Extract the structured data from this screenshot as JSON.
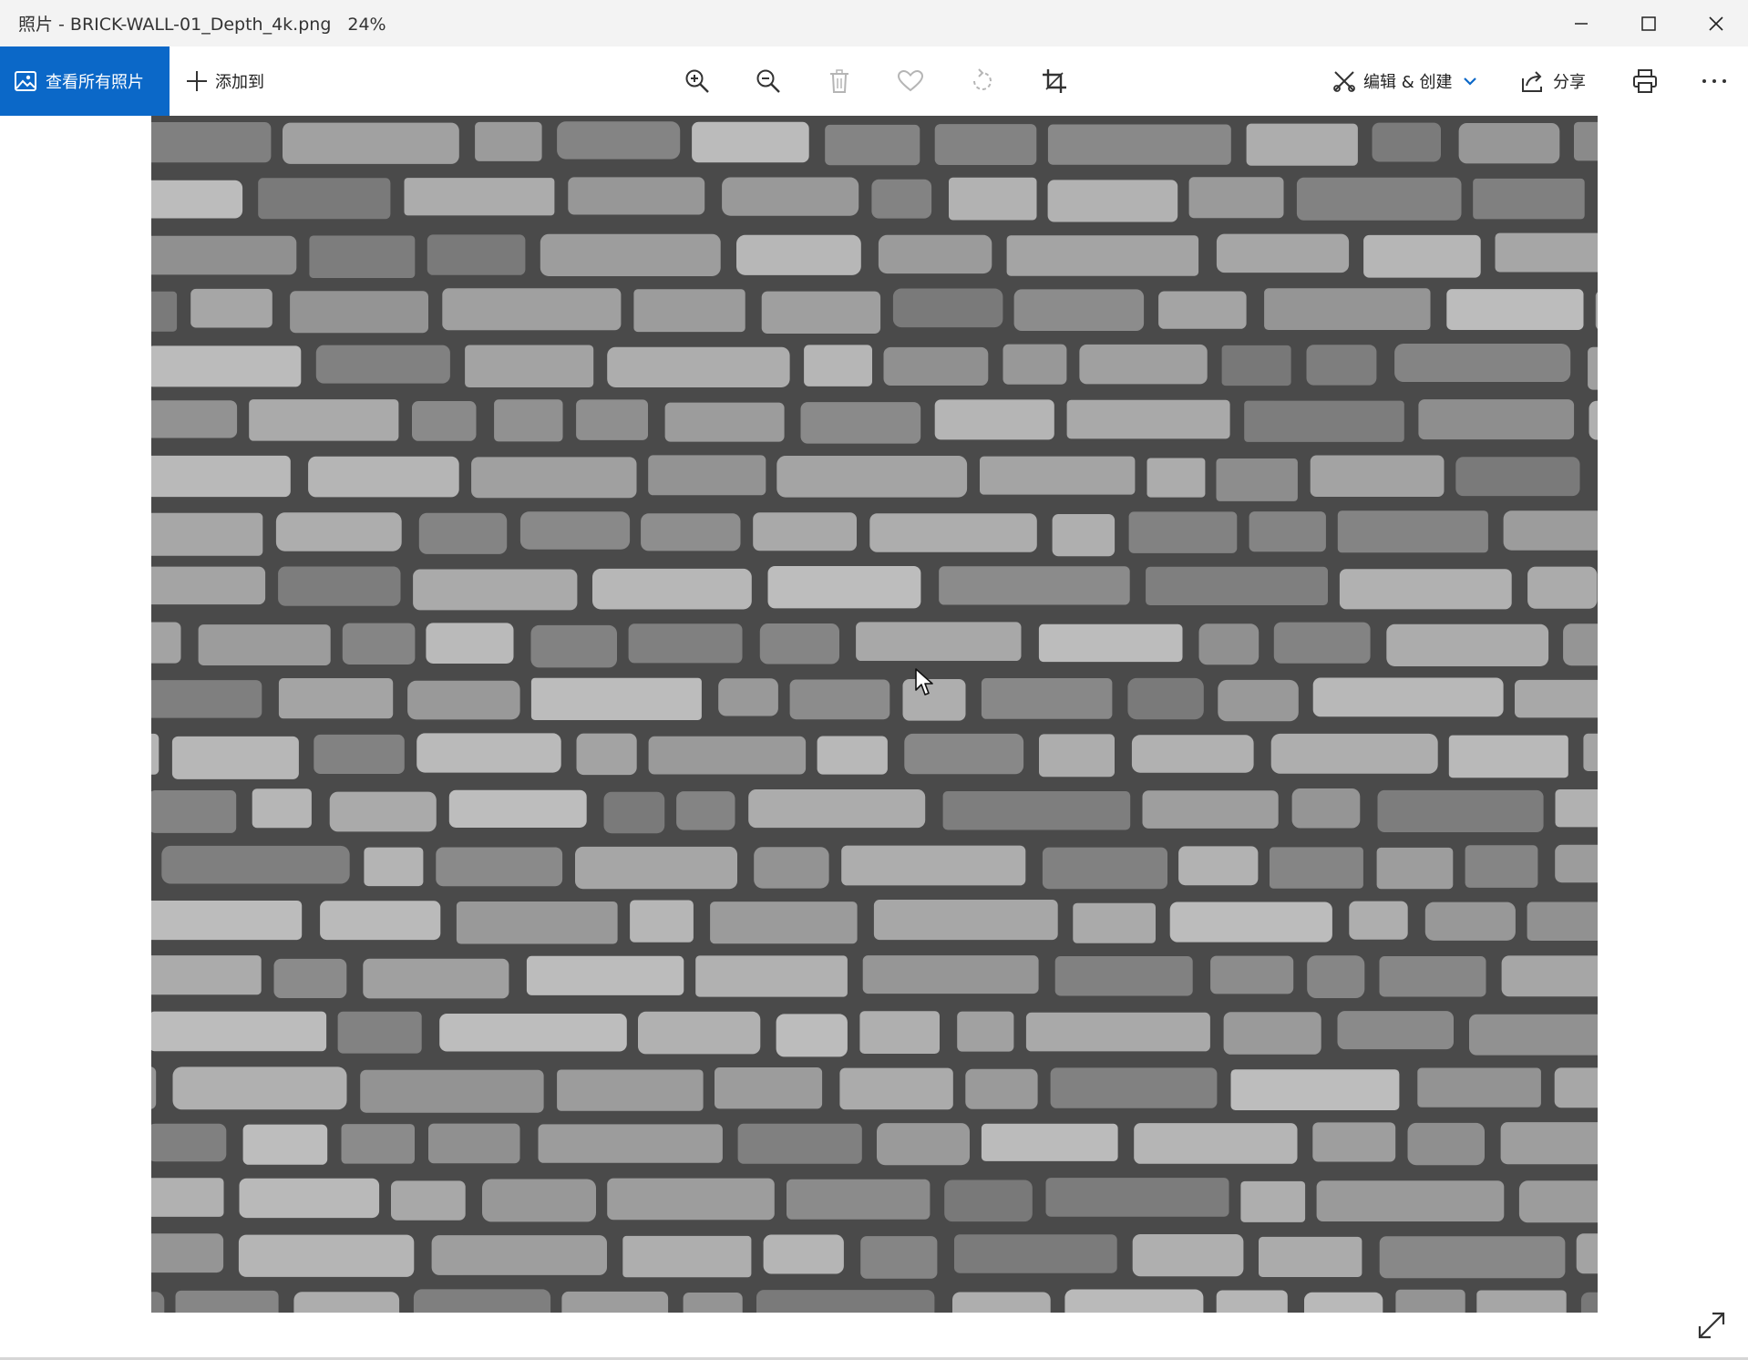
{
  "window": {
    "title": "照片 - BRICK-WALL-01_Depth_4k.png",
    "zoom": "24%"
  },
  "toolbar": {
    "view_all_label": "查看所有照片",
    "add_to_label": "添加到",
    "edit_create_label": "编辑 & 创建",
    "share_label": "分享"
  },
  "image": {
    "subject": "grayscale brick wall depth map"
  },
  "colors": {
    "accent": "#0b68c8",
    "titlebar": "#f3f3f3"
  }
}
